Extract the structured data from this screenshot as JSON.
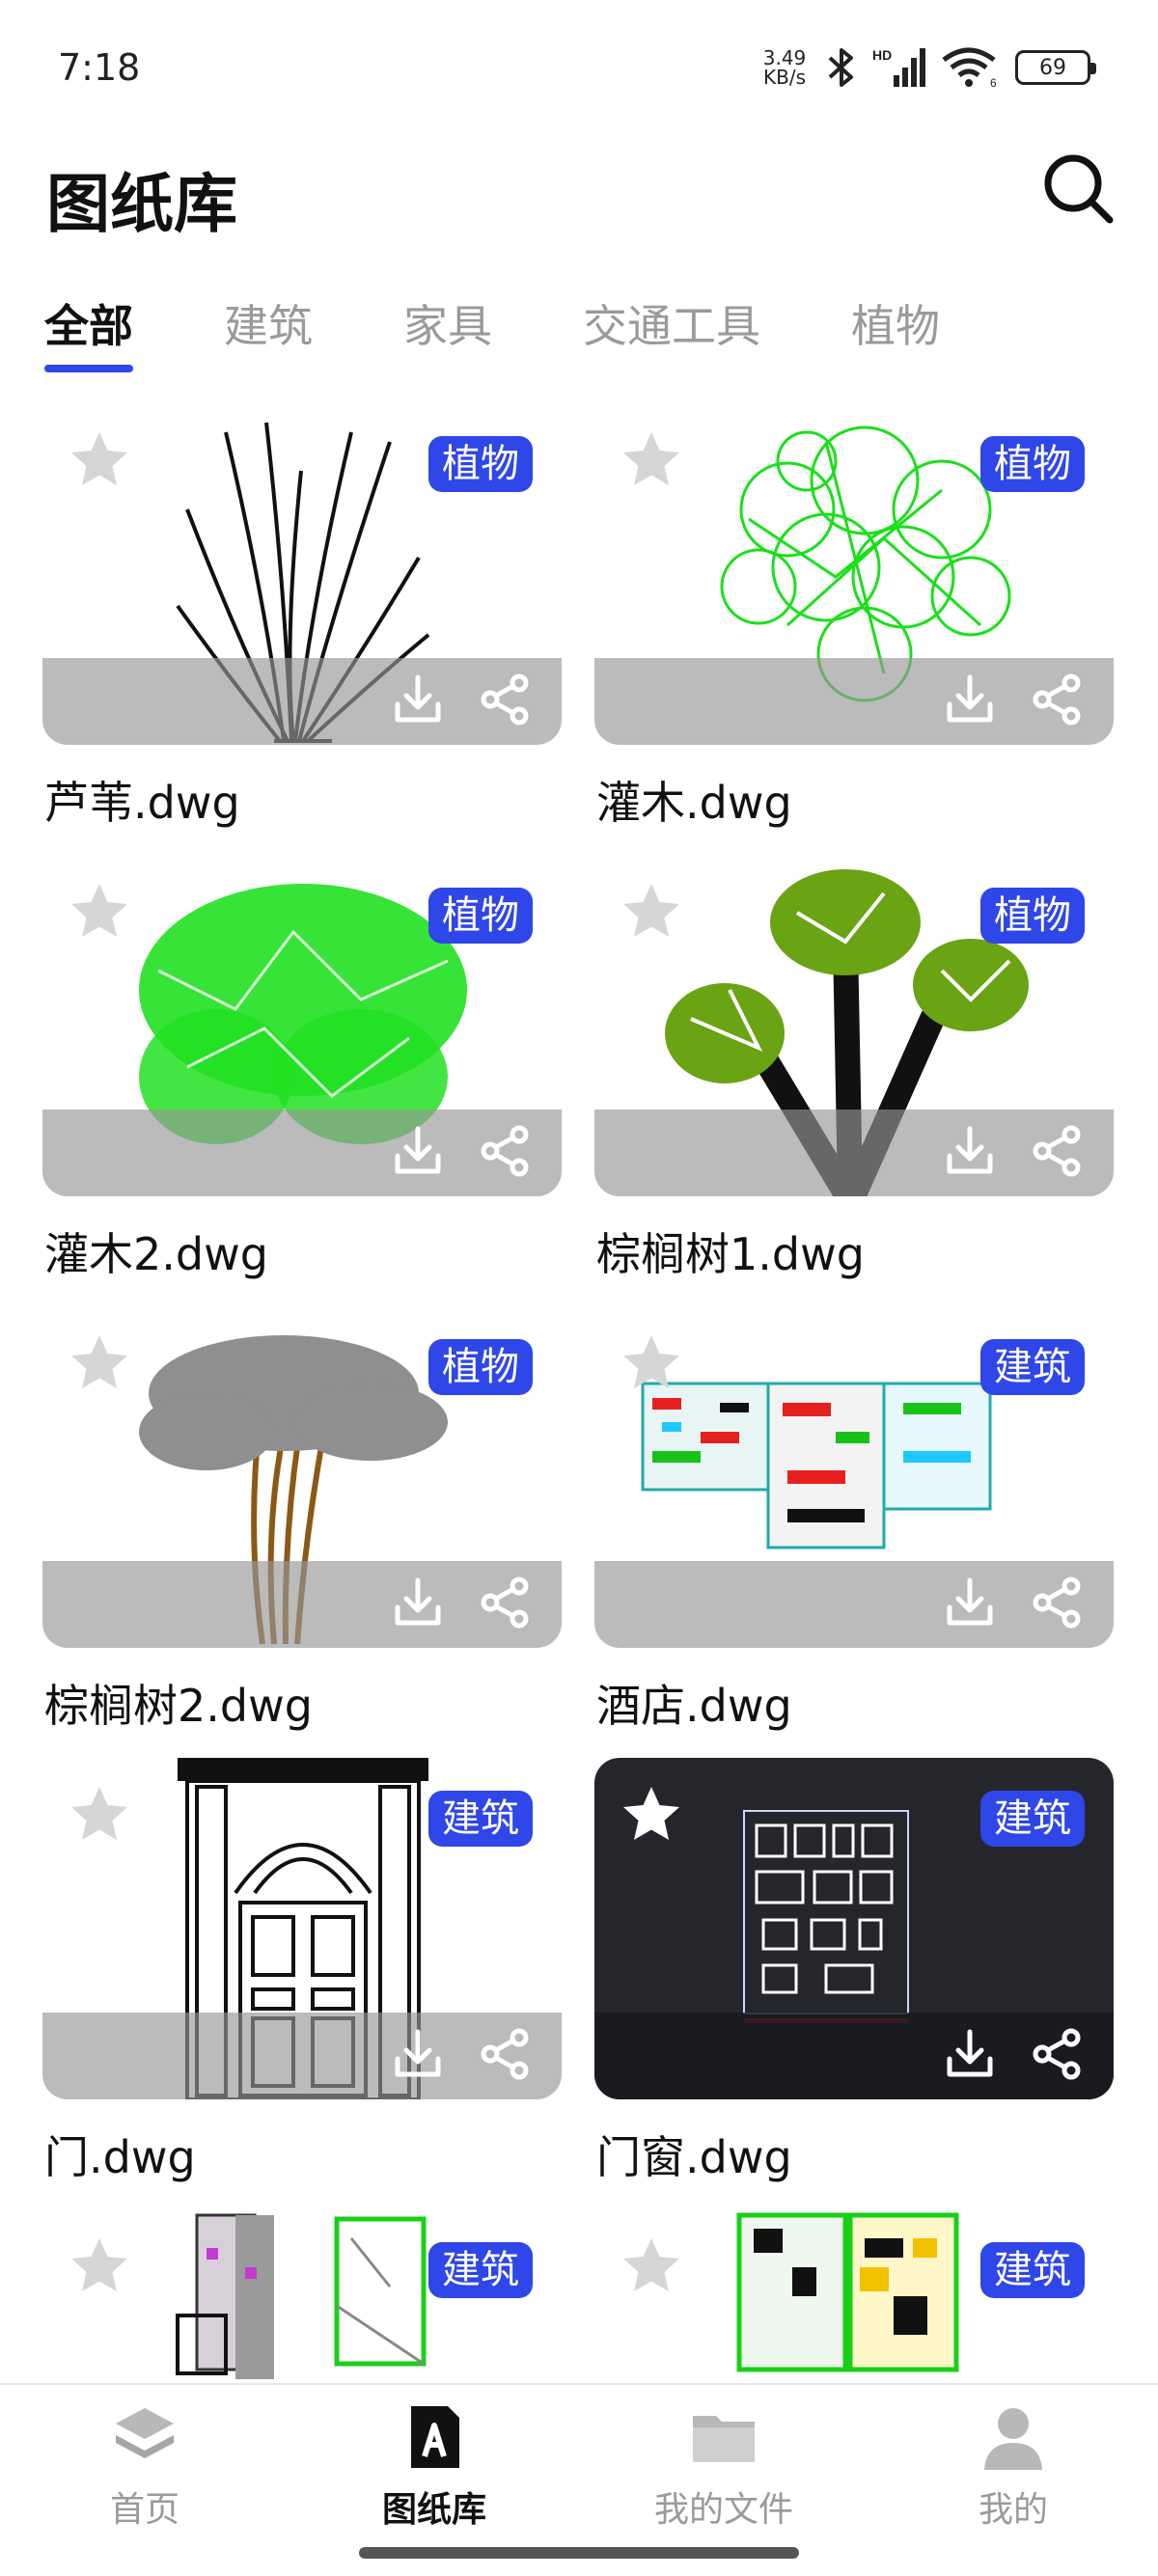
{
  "status_bar": {
    "time": "7:18",
    "net_speed_value": "3.49",
    "net_speed_unit": "KB/s",
    "network_badge": "HD",
    "wifi_badge": "6",
    "battery": "69",
    "icons": [
      "bluetooth-icon",
      "signal-icon",
      "wifi-icon",
      "battery-icon"
    ]
  },
  "header": {
    "title": "图纸库",
    "search_icon": "search-icon"
  },
  "tabs": [
    {
      "label": "全部",
      "active": true
    },
    {
      "label": "建筑",
      "active": false
    },
    {
      "label": "家具",
      "active": false
    },
    {
      "label": "交通工具",
      "active": false
    },
    {
      "label": "植物",
      "active": false
    }
  ],
  "cards": [
    {
      "name": "芦苇.dwg",
      "tag": "植物",
      "favorited": false
    },
    {
      "name": "灌木.dwg",
      "tag": "植物",
      "favorited": false
    },
    {
      "name": "灌木2.dwg",
      "tag": "植物",
      "favorited": false
    },
    {
      "name": "棕榈树1.dwg",
      "tag": "植物",
      "favorited": false
    },
    {
      "name": "棕榈树2.dwg",
      "tag": "植物",
      "favorited": false
    },
    {
      "name": "酒店.dwg",
      "tag": "建筑",
      "favorited": false
    },
    {
      "name": "门.dwg",
      "tag": "建筑",
      "favorited": false
    },
    {
      "name": "门窗.dwg",
      "tag": "建筑",
      "favorited": false
    },
    {
      "name": "",
      "tag": "建筑",
      "favorited": false
    },
    {
      "name": "",
      "tag": "建筑",
      "favorited": false
    }
  ],
  "bottom_nav": [
    {
      "label": "首页",
      "icon": "layers-icon",
      "active": false
    },
    {
      "label": "图纸库",
      "icon": "drawing-library-icon",
      "active": true
    },
    {
      "label": "我的文件",
      "icon": "folder-icon",
      "active": false
    },
    {
      "label": "我的",
      "icon": "user-icon",
      "active": false
    }
  ],
  "colors": {
    "accent": "#2f46e8",
    "card_band": "#969696",
    "inactive_text": "#9a9a9a"
  }
}
